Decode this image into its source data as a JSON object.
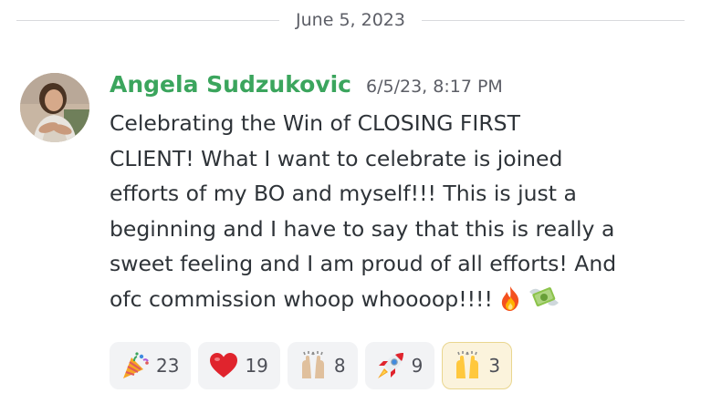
{
  "divider": {
    "date": "June 5, 2023"
  },
  "message": {
    "author": "Angela Sudzukovic",
    "timestamp": "6/5/23, 8:17 PM",
    "lines": [
      "Celebrating the Win of CLOSING FIRST",
      "CLIENT! What I want to celebrate is joined",
      "efforts of my BO and myself!!! This is just a",
      "beginning and I have to say that this is really a",
      "sweet feeling and I am proud of all efforts! And",
      "ofc commission whoop whoooop!!!!"
    ],
    "inline_emojis": [
      "fire-emoji",
      "money-with-wings-emoji"
    ],
    "author_color": "#3ba55d"
  },
  "reactions": [
    {
      "emoji": "party-popper-emoji",
      "count": "23",
      "active": false
    },
    {
      "emoji": "red-heart-emoji",
      "count": "19",
      "active": false
    },
    {
      "emoji": "raising-hands-light-emoji",
      "count": "8",
      "active": false
    },
    {
      "emoji": "rocket-emoji",
      "count": "9",
      "active": false
    },
    {
      "emoji": "raising-hands-emoji",
      "count": "3",
      "active": true
    }
  ]
}
